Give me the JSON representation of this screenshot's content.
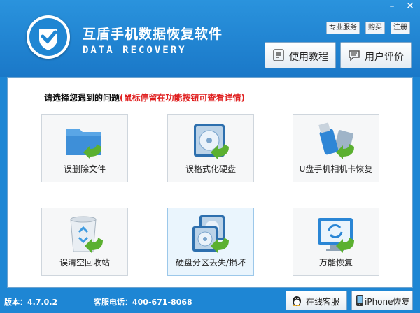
{
  "app": {
    "title": "互盾手机数据恢复软件",
    "subtitle": "DATA RECOVERY",
    "window_buttons": {
      "minimize": "–",
      "close": "✕"
    },
    "links": [
      "专业服务",
      "购买",
      "注册"
    ]
  },
  "header_buttons": {
    "tutorial": "使用教程",
    "review": "用户评价"
  },
  "main": {
    "prompt": "请选择您遇到的问题",
    "hint": "(鼠标停留在功能按钮可查看详情)",
    "options": [
      {
        "label": "误删除文件",
        "icon": "folder-icon"
      },
      {
        "label": "误格式化硬盘",
        "icon": "hard-disk-icon"
      },
      {
        "label": "U盘手机相机卡恢复",
        "icon": "usb-drive-icon"
      },
      {
        "label": "误清空回收站",
        "icon": "recycle-bin-icon"
      },
      {
        "label": "硬盘分区丢失/损坏",
        "icon": "partition-disks-icon"
      },
      {
        "label": "万能恢复",
        "icon": "monitor-refresh-icon"
      }
    ]
  },
  "footer": {
    "version": "版本：4.7.0.2",
    "phone": "客服电话：400-671-8068",
    "online_service": "在线客服",
    "iphone_recovery": "iPhone恢复"
  },
  "colors": {
    "frame": "#1e86d4",
    "hint": "#e02020",
    "arrow": "#5bb030"
  }
}
